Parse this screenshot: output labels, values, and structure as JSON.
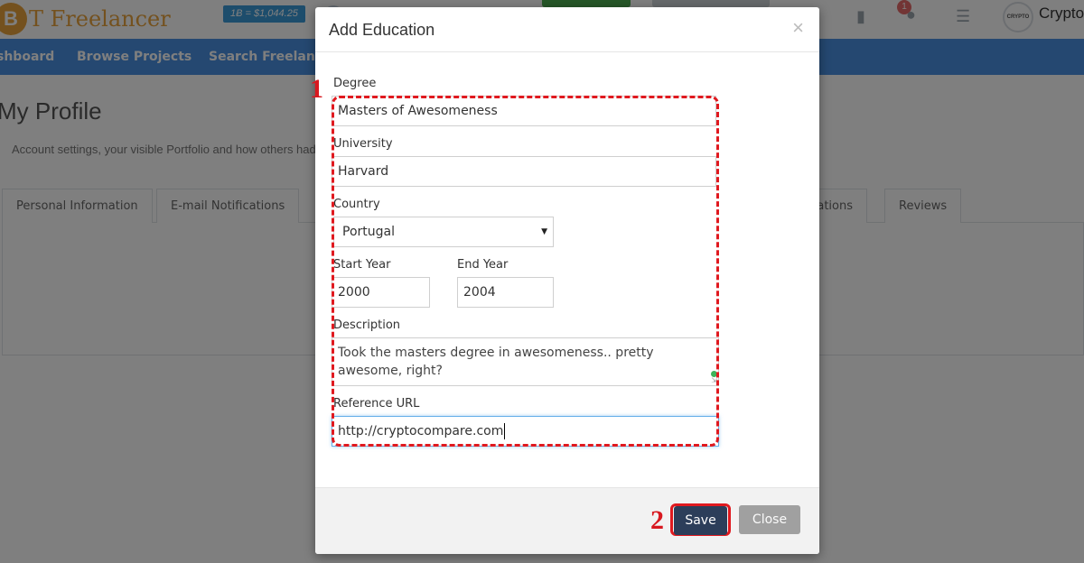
{
  "app": {
    "logo_letter": "B",
    "logo_text": "T Freelancer",
    "price_badge": "1Ƀ = $1,044.25",
    "notification_count": "1",
    "avatar_text": "CRYPTO",
    "user_label": "Crypto"
  },
  "nav": {
    "items": [
      {
        "label": "shboard"
      },
      {
        "label": "Browse Projects"
      },
      {
        "label": "Search Freelanc"
      }
    ]
  },
  "page": {
    "title": "My Profile",
    "subtitle": "Account settings, your visible Portfolio and how others had",
    "tabs": [
      {
        "label": "Personal Information"
      },
      {
        "label": "E-mail Notifications"
      },
      {
        "label": "lications"
      },
      {
        "label": "Reviews"
      }
    ]
  },
  "modal": {
    "title": "Add Education",
    "close_glyph": "×",
    "fields": {
      "degree_label": "Degree",
      "degree_value": "Masters of Awesomeness",
      "university_label": "University",
      "university_value": "Harvard",
      "country_label": "Country",
      "country_value": "Portugal",
      "start_year_label": "Start Year",
      "start_year_value": "2000",
      "end_year_label": "End Year",
      "end_year_value": "2004",
      "description_label": "Description",
      "description_value": "Took the masters degree in awesomeness.. pretty awesome, right?",
      "reference_url_label": "Reference URL",
      "reference_url_value": "http://cryptocompare.com"
    },
    "buttons": {
      "save": "Save",
      "close": "Close"
    }
  },
  "annotations": {
    "step1": "1",
    "step2": "2",
    "color": "#e0191f"
  },
  "colors": {
    "navbar": "#4a90e2",
    "save_button": "#2c3e5a",
    "close_button": "#a0a0a0",
    "logo": "#e8a33d"
  }
}
